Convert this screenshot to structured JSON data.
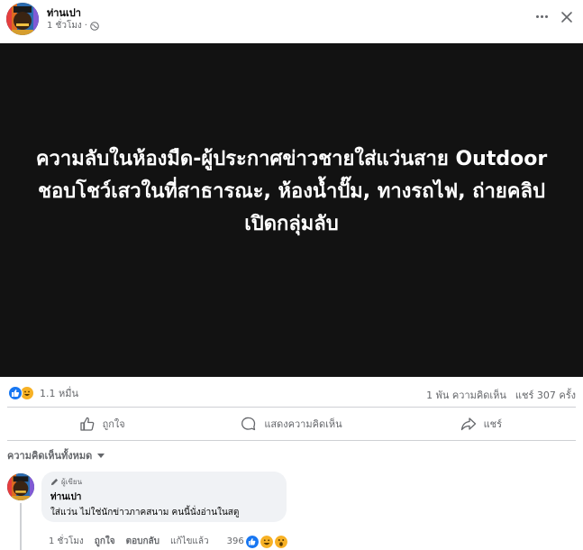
{
  "post": {
    "author": "ท่านเปา",
    "time": "1 ชั่วโมง",
    "time_separator": "·",
    "privacy_icon": "public-globe-icon",
    "media_text": "ความลับในห้องมืด-ผู้ประกาศข่าวชายใส่แว่นสาย Outdoor ชอบโชว์เสวในที่สาธารณะ, ห้องน้ำปั๊ม, ทางรถไฟ, ถ่ายคลิป เปิดกลุ่มลับ"
  },
  "stats": {
    "reaction_count": "1.1 หมื่น",
    "comments": "1 พัน ความคิดเห็น",
    "shares": "แชร์ 307 ครั้ง"
  },
  "actions": {
    "like": "ถูกใจ",
    "comment": "แสดงความคิดเห็น",
    "share": "แชร์"
  },
  "comments_section": {
    "sort_label": "ความคิดเห็นทั้งหมด"
  },
  "comment": {
    "badge": "ผู้เขียน",
    "author": "ท่านเปา",
    "text": "ใส่แว่น ไม่ใช่นักข่าวภาคสนาม คนนี้นั่งอ่านในสตู",
    "time": "1 ชั่วโมง",
    "like_label": "ถูกใจ",
    "reply_label": "ตอบกลับ",
    "edit_label": "แก้ไขแล้ว",
    "reaction_count": "396"
  },
  "colors": {
    "like_blue": "#1877f2",
    "haha_yellow": "#f7b125",
    "secondary_text": "#65676b",
    "media_bg": "#121212"
  }
}
